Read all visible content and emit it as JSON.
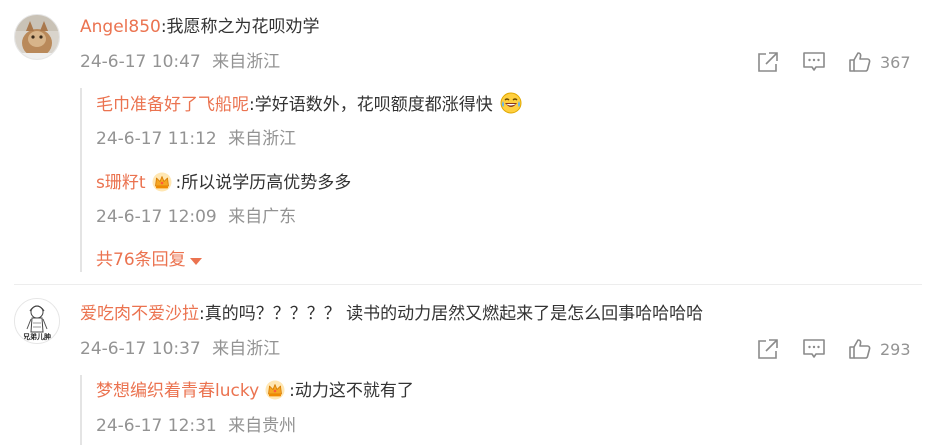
{
  "comments": [
    {
      "username": "Angel850",
      "text": ":我愿称之为花呗劝学",
      "time": "24-6-17 10:47",
      "location": "来自浙江",
      "likes": "367",
      "replies": [
        {
          "username": "毛巾准备好了飞船呢",
          "text": ":学好语数外，花呗额度都涨得快",
          "emoji": "laugh-cry-emoji",
          "time": "24-6-17 11:12",
          "location": "来自浙江"
        },
        {
          "username": "s珊籽t",
          "badge": "crown-badge",
          "text": ":所以说学历高优势多多",
          "time": "24-6-17 12:09",
          "location": "来自广东"
        }
      ],
      "more_replies": "共76条回复"
    },
    {
      "username": "爱吃肉不爱沙拉",
      "text": ":真的吗？？？？？ 读书的动力居然又燃起来了是怎么回事哈哈哈哈",
      "time": "24-6-17 10:37",
      "location": "来自浙江",
      "likes": "293",
      "replies": [
        {
          "username": "梦想编织着青春lucky",
          "badge": "crown-badge",
          "text": ":动力这不就有了",
          "time": "24-6-17 12:31",
          "location": "来自贵州"
        }
      ]
    }
  ],
  "avatar2_caption": "兄弟儿肿",
  "colors": {
    "username": "#eb7350",
    "meta": "#939393",
    "text": "#333333"
  }
}
